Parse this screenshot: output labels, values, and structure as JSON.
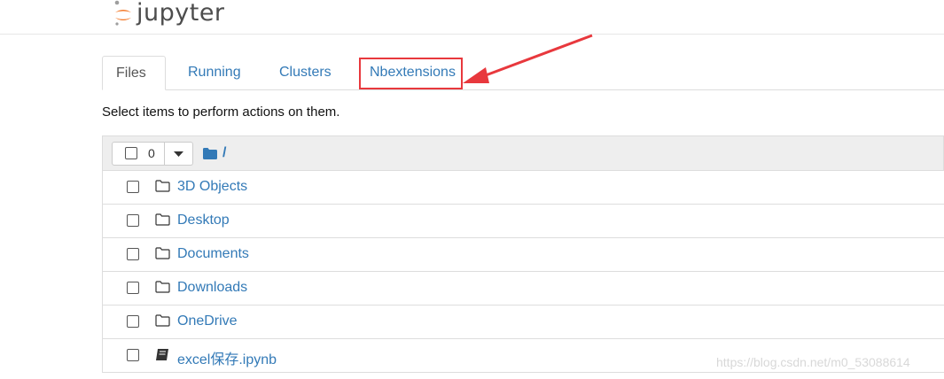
{
  "header": {
    "logo_text": "jupyter"
  },
  "tabs": [
    {
      "label": "Files",
      "active": true
    },
    {
      "label": "Running",
      "active": false
    },
    {
      "label": "Clusters",
      "active": false
    },
    {
      "label": "Nbextensions",
      "active": false,
      "highlighted": true
    }
  ],
  "hint": "Select items to perform actions on them.",
  "toolbar": {
    "selected_count": "0",
    "path": "/"
  },
  "items": [
    {
      "name": "3D Objects",
      "type": "folder"
    },
    {
      "name": "Desktop",
      "type": "folder"
    },
    {
      "name": "Documents",
      "type": "folder"
    },
    {
      "name": "Downloads",
      "type": "folder"
    },
    {
      "name": "OneDrive",
      "type": "folder"
    },
    {
      "name": "excel保存.ipynb",
      "type": "notebook"
    }
  ],
  "watermark": "https://blog.csdn.net/m0_53088614",
  "colors": {
    "link": "#337ab7",
    "annotation": "#e8383d",
    "logo_orange": "#f37726"
  }
}
